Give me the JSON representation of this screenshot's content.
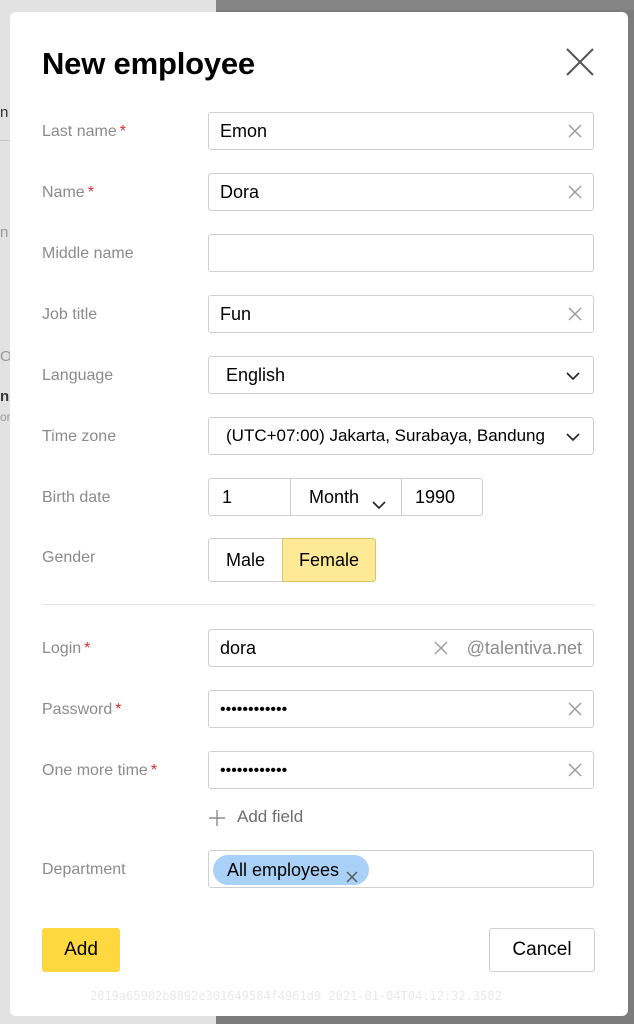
{
  "background": {
    "fragments": [
      "n",
      "n",
      "O",
      "n",
      "or"
    ]
  },
  "dialog": {
    "title": "New employee",
    "close_icon": "close-icon"
  },
  "form": {
    "last_name": {
      "label": "Last name",
      "required_mark": "*",
      "value": "Emon"
    },
    "name": {
      "label": "Name",
      "required_mark": "*",
      "value": "Dora"
    },
    "middle_name": {
      "label": "Middle name",
      "value": ""
    },
    "job_title": {
      "label": "Job title",
      "value": "Fun"
    },
    "language": {
      "label": "Language",
      "value": "English"
    },
    "time_zone": {
      "label": "Time zone",
      "value": "(UTC+07:00) Jakarta, Surabaya, Bandung"
    },
    "birth_date": {
      "label": "Birth date",
      "day": "1",
      "month": "Month",
      "year": "1990"
    },
    "gender": {
      "label": "Gender",
      "options": [
        "Male",
        "Female"
      ],
      "selected": "Female"
    },
    "login": {
      "label": "Login",
      "required_mark": "*",
      "value": "dora",
      "suffix": "@talentiva.net"
    },
    "password": {
      "label": "Password",
      "required_mark": "*",
      "value": "••••••••••••"
    },
    "password_repeat": {
      "label": "One more time",
      "required_mark": "*",
      "value": "••••••••••••"
    },
    "add_field": {
      "label": "Add field"
    },
    "department": {
      "label": "Department",
      "tag": "All employees"
    }
  },
  "actions": {
    "add_label": "Add",
    "cancel_label": "Cancel"
  },
  "footer": {
    "build_id": "2019a65902b8892e301649584f4961d9 2021-01-04T04:12:32.3582"
  },
  "colors": {
    "accent_yellow": "#fdd83e",
    "selected_segment": "#fde996",
    "tag_blue": "#a9d1f7",
    "required_red": "#e0292a",
    "label_gray": "#8b8b8b"
  }
}
